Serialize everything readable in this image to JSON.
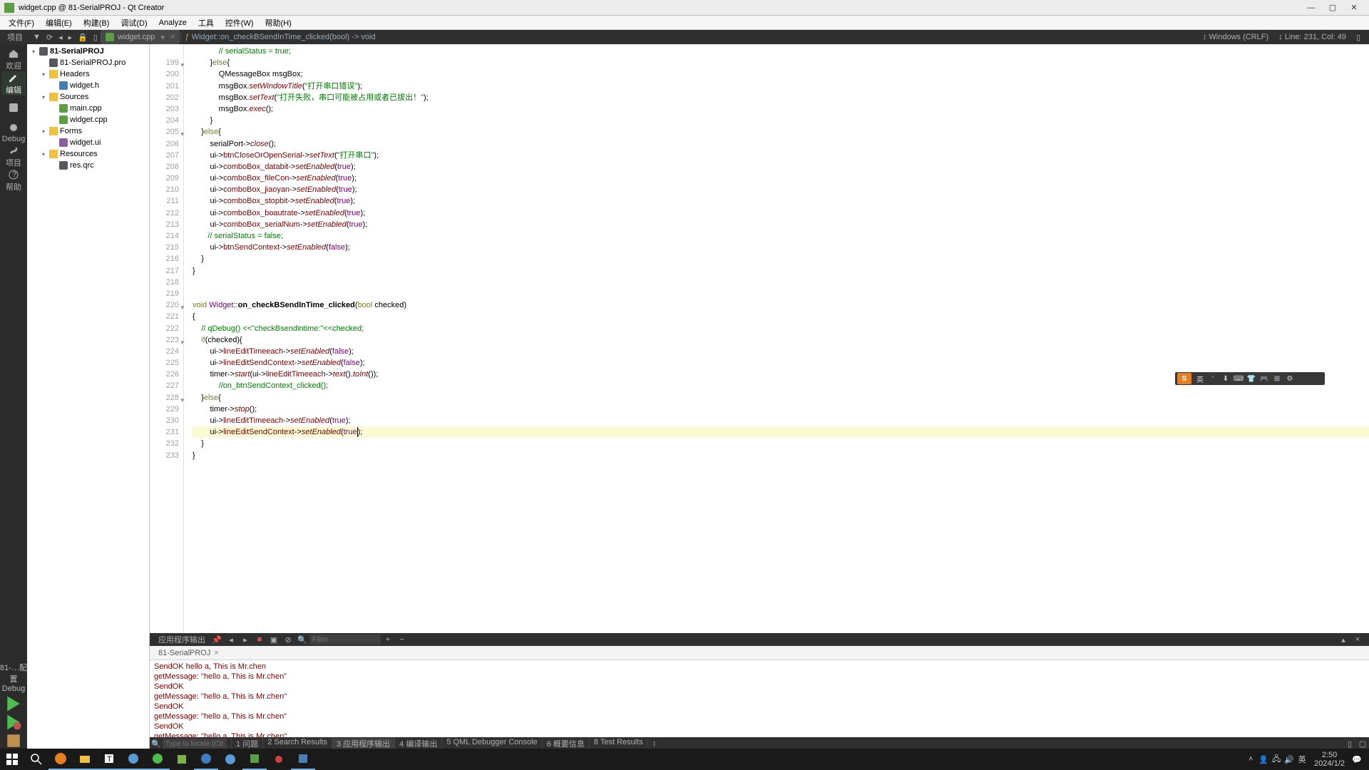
{
  "window": {
    "title": "widget.cpp @ 81-SerialPROJ - Qt Creator"
  },
  "menu": [
    "文件(F)",
    "编辑(E)",
    "构建(B)",
    "调试(D)",
    "Analyze",
    "工具",
    "控件(W)",
    "帮助(H)"
  ],
  "topstrip": {
    "proj": "项目",
    "tab": "widget.cpp",
    "crumb": "Widget::on_checkBSendInTime_clicked(bool) -> void",
    "encoding": "↕ Windows (CRLF)",
    "pos": "↕ Line: 231, Col: 49"
  },
  "modes": [
    {
      "label": "欢迎",
      "icon": "home"
    },
    {
      "label": "编辑",
      "icon": "edit",
      "active": true
    },
    {
      "label": "",
      "icon": "design"
    },
    {
      "label": "Debug",
      "icon": "bug"
    },
    {
      "label": "项目",
      "icon": "wrench"
    },
    {
      "label": "帮助",
      "icon": "help"
    }
  ],
  "kit": {
    "line1": "81-…配置",
    "line2": "Debug"
  },
  "tree": [
    {
      "pad": 0,
      "twisty": "▾",
      "icon": "file-pro",
      "bold": true,
      "label": "81-SerialPROJ"
    },
    {
      "pad": 1,
      "twisty": "",
      "icon": "file-pro",
      "label": "81-SerialPROJ.pro"
    },
    {
      "pad": 1,
      "twisty": "▾",
      "icon": "folder",
      "label": "Headers"
    },
    {
      "pad": 2,
      "twisty": "",
      "icon": "file-h",
      "label": "widget.h"
    },
    {
      "pad": 1,
      "twisty": "▾",
      "icon": "folder",
      "label": "Sources"
    },
    {
      "pad": 2,
      "twisty": "",
      "icon": "file-cpp",
      "label": "main.cpp"
    },
    {
      "pad": 2,
      "twisty": "",
      "icon": "file-cpp",
      "label": "widget.cpp"
    },
    {
      "pad": 1,
      "twisty": "▾",
      "icon": "folder",
      "label": "Forms"
    },
    {
      "pad": 2,
      "twisty": "",
      "icon": "file-ui",
      "label": "widget.ui"
    },
    {
      "pad": 1,
      "twisty": "▾",
      "icon": "folder",
      "label": "Resources"
    },
    {
      "pad": 2,
      "twisty": "",
      "icon": "file-pro",
      "label": "res.qrc"
    }
  ],
  "code": {
    "first_line": 198,
    "lines": [
      {
        "n": "",
        "html": "            <span class='cmt'>// serialStatus = true;</span>"
      },
      {
        "n": 199,
        "fold": "▾",
        "html": "        }<span class='kw'>else</span>{"
      },
      {
        "n": 200,
        "html": "            <span class='op'>QMessageBox</span> <span class='op'>msgBox</span>;"
      },
      {
        "n": 201,
        "html": "            msgBox.<span class='fn'>setWindowTitle</span>(<span class='str'>\"打开串口错误\"</span>);"
      },
      {
        "n": 202,
        "html": "            msgBox.<span class='fn'>setText</span>(<span class='str'>\"打开失败，串口可能被占用或者已拔出！\"</span>);"
      },
      {
        "n": 203,
        "html": "            msgBox.<span class='fn'>exec</span>();"
      },
      {
        "n": 204,
        "html": "        }"
      },
      {
        "n": 205,
        "fold": "▾",
        "html": "    }<span class='kw'>else</span>{"
      },
      {
        "n": 206,
        "html": "        serialPort-><span class='fn'>close</span>();"
      },
      {
        "n": 207,
        "html": "        ui-><span class='id'>btnCloseOrOpenSerial</span>-><span class='fn'>setText</span>(<span class='str'>\"打开串口\"</span>);"
      },
      {
        "n": 208,
        "html": "        ui-><span class='id'>comboBox_databit</span>-><span class='fn'>setEnabled</span>(<span class='lit'>true</span>);"
      },
      {
        "n": 209,
        "html": "        ui-><span class='id'>comboBox_fileCon</span>-><span class='fn'>setEnabled</span>(<span class='lit'>true</span>);"
      },
      {
        "n": 210,
        "html": "        ui-><span class='id'>comboBox_jiaoyan</span>-><span class='fn'>setEnabled</span>(<span class='lit'>true</span>);"
      },
      {
        "n": 211,
        "html": "        ui-><span class='id'>comboBox_stopbit</span>-><span class='fn'>setEnabled</span>(<span class='lit'>true</span>);"
      },
      {
        "n": 212,
        "html": "        ui-><span class='id'>comboBox_boautrate</span>-><span class='fn'>setEnabled</span>(<span class='lit'>true</span>);"
      },
      {
        "n": 213,
        "html": "        ui-><span class='id'>comboBox_serialNum</span>-><span class='fn'>setEnabled</span>(<span class='lit'>true</span>);"
      },
      {
        "n": 214,
        "html": "       <span class='cmt'>// serialStatus = false;</span>"
      },
      {
        "n": 215,
        "html": "        ui-><span class='id'>btnSendContext</span>-><span class='fn'>setEnabled</span>(<span class='lit'>false</span>);"
      },
      {
        "n": 216,
        "html": "    }"
      },
      {
        "n": 217,
        "html": "}"
      },
      {
        "n": 218,
        "html": ""
      },
      {
        "n": 219,
        "html": ""
      },
      {
        "n": 220,
        "fold": "▾",
        "html": "<span class='kw'>void</span> <span class='lit'>Widget</span>::<span class='boldfn'>on_checkBSendInTime_clicked</span>(<span class='kw'>bool</span> checked)"
      },
      {
        "n": 221,
        "html": "{"
      },
      {
        "n": 222,
        "html": "    <span class='cmt'>// qDebug() &lt;&lt;\"checkBsendintime:\"&lt;&lt;checked;</span>"
      },
      {
        "n": 223,
        "fold": "▾",
        "html": "    <span class='kw'>if</span>(checked){"
      },
      {
        "n": 224,
        "html": "        ui-><span class='id'>lineEditTimeeach</span>-><span class='fn'>setEnabled</span>(<span class='lit'>false</span>);"
      },
      {
        "n": 225,
        "html": "        ui-><span class='id'>lineEditSendContext</span>-><span class='fn'>setEnabled</span>(<span class='lit'>false</span>);"
      },
      {
        "n": 226,
        "html": "        timer-><span class='fn'>start</span>(ui-><span class='id'>lineEditTimeeach</span>-><span class='fn'>text</span>().<span class='fn'>toInt</span>());"
      },
      {
        "n": 227,
        "html": "            <span class='cmt'>//on_btnSendContext_clicked();</span>"
      },
      {
        "n": 228,
        "fold": "▾",
        "html": "    }<span class='kw'>else</span>{"
      },
      {
        "n": 229,
        "html": "        timer-><span class='fn'>stop</span>();"
      },
      {
        "n": 230,
        "html": "        ui-><span class='id'>lineEditTimeeach</span>-><span class='fn'>setEnabled</span>(<span class='lit'>true</span>);"
      },
      {
        "n": 231,
        "cursor": true,
        "html": "        ui-><span class='id'>lineEditSendContext</span>-><span class='fn'>setEnabled</span>(<span class='lit'>true</span><span class='caret'></span>);"
      },
      {
        "n": 232,
        "html": "    }"
      },
      {
        "n": 233,
        "html": "}"
      }
    ]
  },
  "output_toolbar": {
    "title": "应用程序输出",
    "filter_placeholder": "Filter"
  },
  "output_tab": "81-SerialPROJ",
  "output_lines": [
    "SendOK hello a, This is Mr.chen",
    "getMessage: \"hello a, This is Mr.chen\"",
    "SendOK",
    "getMessage: \"hello a, This is Mr.chen\"",
    "SendOK",
    "getMessage: \"hello a, This is Mr.chen\"",
    "SendOK",
    "getMessage: \"hello a, This is Mr.chen\""
  ],
  "bottombar": {
    "locator_placeholder": "Type to locate (Ctr",
    "panels": [
      "1 问题",
      "2 Search Results",
      "3 应用程序输出",
      "4 编译输出",
      "5 QML Debugger Console",
      "6 概要信息",
      "8 Test Results"
    ],
    "active_panel": 2
  },
  "ime": {
    "logo": "S",
    "mode": "英"
  },
  "clock": {
    "time": "2:50",
    "date": "2024/1/2"
  }
}
